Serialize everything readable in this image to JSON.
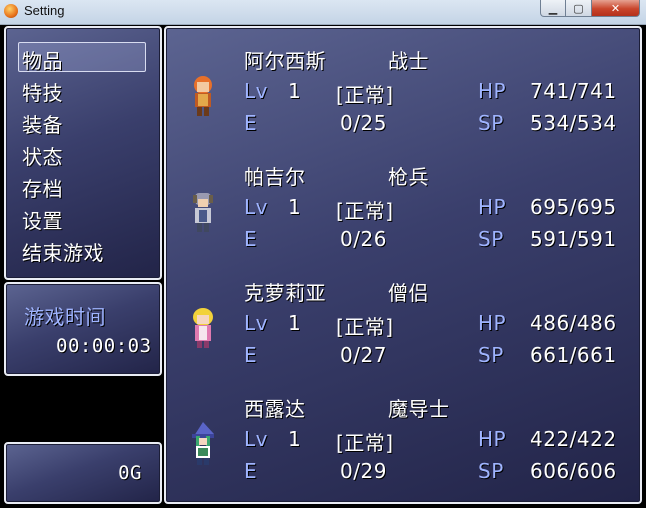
{
  "window": {
    "title": "Setting",
    "minimize": "▁",
    "maximize": "▢",
    "close": "✕"
  },
  "menu": {
    "items": [
      "物品",
      "特技",
      "装备",
      "状态",
      "存档",
      "设置",
      "结束游戏"
    ],
    "selected_index": 0
  },
  "playtime": {
    "label": "游戏时间",
    "value": "00:00:03"
  },
  "gold": {
    "value": "0G"
  },
  "party": [
    {
      "name": "阿尔西斯",
      "class": "战士",
      "lv_label": "Lv",
      "level": "1",
      "state": "[正常]",
      "e_label": "E",
      "exp": "0/25",
      "hp_label": "HP",
      "hp": "741/741",
      "sp_label": "SP",
      "sp": "534/534"
    },
    {
      "name": "帕吉尔",
      "class": "枪兵",
      "lv_label": "Lv",
      "level": "1",
      "state": "[正常]",
      "e_label": "E",
      "exp": "0/26",
      "hp_label": "HP",
      "hp": "695/695",
      "sp_label": "SP",
      "sp": "591/591"
    },
    {
      "name": "克萝莉亚",
      "class": "僧侣",
      "lv_label": "Lv",
      "level": "1",
      "state": "[正常]",
      "e_label": "E",
      "exp": "0/27",
      "hp_label": "HP",
      "hp": "486/486",
      "sp_label": "SP",
      "sp": "661/661"
    },
    {
      "name": "西露达",
      "class": "魔导士",
      "lv_label": "Lv",
      "level": "1",
      "state": "[正常]",
      "e_label": "E",
      "exp": "0/29",
      "hp_label": "HP",
      "hp": "422/422",
      "sp_label": "SP",
      "sp": "606/606"
    }
  ],
  "colors": {
    "system_text": "#9fb4ff",
    "panel_top": "#5c6491",
    "panel_bottom": "#222448"
  }
}
